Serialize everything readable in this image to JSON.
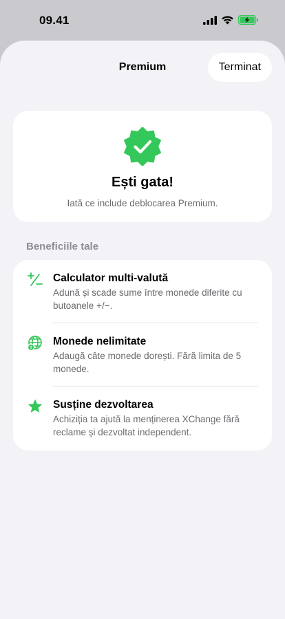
{
  "status_bar": {
    "time": "09.41",
    "icons": [
      "cellular-signal-icon",
      "wifi-icon",
      "battery-charging-icon"
    ]
  },
  "nav": {
    "title": "Premium",
    "done_label": "Terminat"
  },
  "hero": {
    "icon": "checkmark-seal-icon",
    "title": "Ești gata!",
    "subtitle": "Iată ce include deblocarea Premium."
  },
  "benefits": {
    "header": "Beneficiile tale",
    "items": [
      {
        "icon": "plus-minus-icon",
        "title": "Calculator multi-valută",
        "description": "Adună și scade sume între monede diferite cu butoanele +/−."
      },
      {
        "icon": "globe-icon",
        "title": "Monede nelimitate",
        "description": "Adaugă câte monede dorești. Fără limita de 5 monede."
      },
      {
        "icon": "star-icon",
        "title": "Susține dezvoltarea",
        "description": "Achiziția ta ajută la menținerea XChange fără reclame și dezvoltat independent."
      }
    ]
  },
  "colors": {
    "accent_green": "#34c759",
    "sheet_background": "#f2f2f7",
    "card_background": "#ffffff",
    "secondary_text": "#6b6b70"
  }
}
